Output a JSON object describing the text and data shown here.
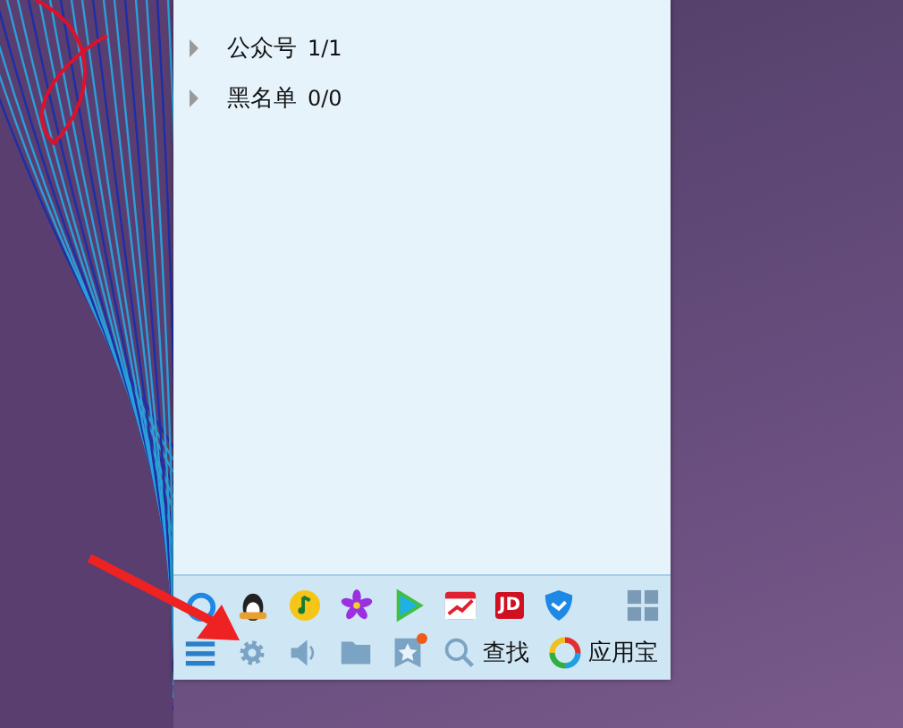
{
  "groups": [
    {
      "name": "公众号",
      "count": "1/1",
      "expanded": false
    },
    {
      "name": "黑名单",
      "count": "0/0",
      "expanded": false
    }
  ],
  "apps": [
    {
      "kind": "browser"
    },
    {
      "kind": "penguin"
    },
    {
      "kind": "music"
    },
    {
      "kind": "flower"
    },
    {
      "kind": "video"
    },
    {
      "kind": "stocks"
    },
    {
      "kind": "shop",
      "label": "JD"
    },
    {
      "kind": "shield"
    }
  ],
  "toolbar": [
    {
      "kind": "menu"
    },
    {
      "kind": "settings"
    },
    {
      "kind": "sound"
    },
    {
      "kind": "folder"
    },
    {
      "kind": "favorites",
      "badge": true
    },
    {
      "kind": "search",
      "label": "查找"
    },
    {
      "kind": "appstore",
      "label": "应用宝"
    }
  ]
}
